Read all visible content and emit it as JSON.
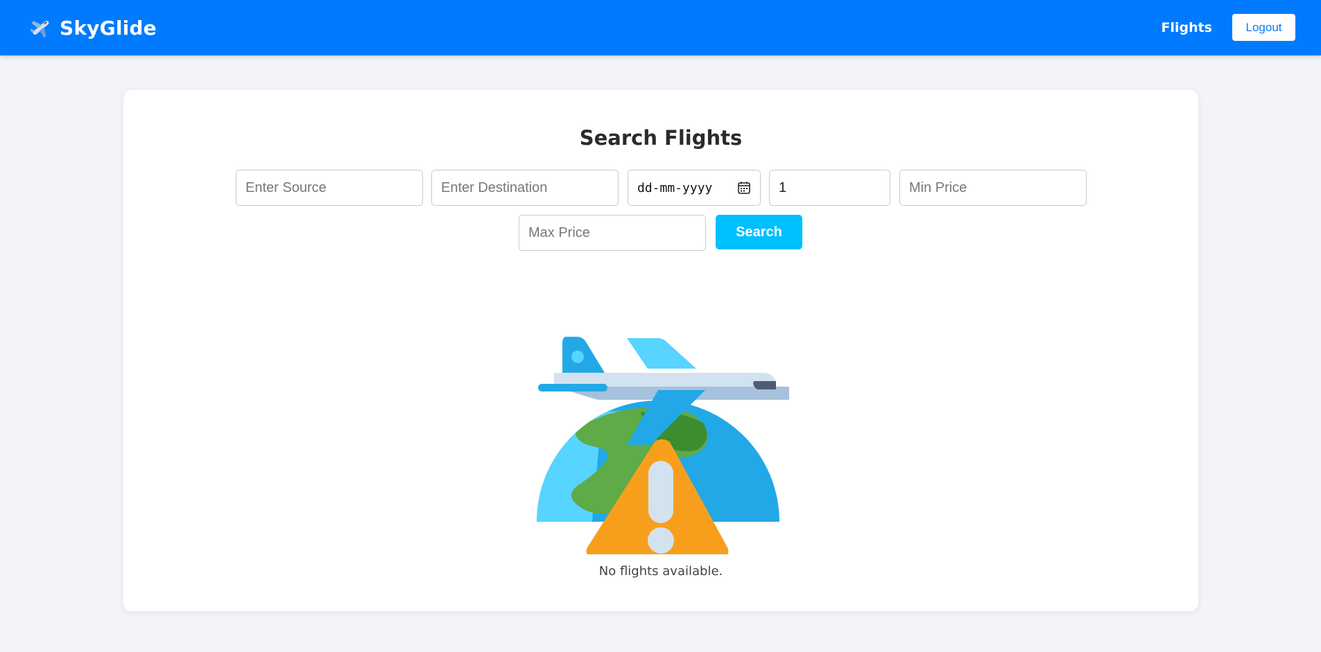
{
  "app": {
    "brand_name": "SkyGlide",
    "brand_icon": "airplane-icon"
  },
  "nav": {
    "flights_label": "Flights",
    "logout_label": "Logout"
  },
  "colors": {
    "navbar": "#007bff",
    "search_button": "#00bfff",
    "background": "#f3f4f7"
  },
  "search": {
    "title": "Search Flights",
    "source_placeholder": "Enter Source",
    "destination_placeholder": "Enter Destination",
    "date_placeholder": "dd-mm-yyyy",
    "date_icon": "calendar-icon",
    "passengers_value": "1",
    "min_price_placeholder": "Min Price",
    "max_price_placeholder": "Max Price",
    "search_label": "Search"
  },
  "results": {
    "illustration": "plane-globe-warning-icon",
    "empty_message": "No flights available."
  }
}
